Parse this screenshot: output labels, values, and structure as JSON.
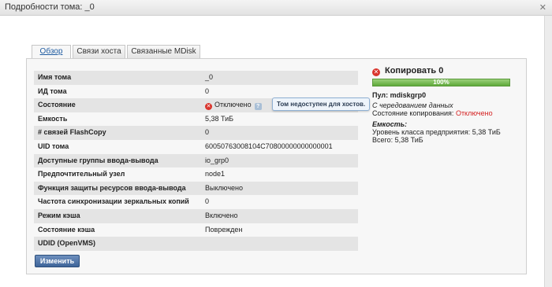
{
  "window": {
    "title": "Подробности тома: _0",
    "close_icon": "close-icon"
  },
  "tabs": [
    {
      "label": "Обзор",
      "active": true
    },
    {
      "label": "Связи хоста",
      "active": false
    },
    {
      "label": "Связанные MDisk",
      "active": false
    }
  ],
  "properties": [
    {
      "label": "Имя тома",
      "value": "_0"
    },
    {
      "label": "ИД тома",
      "value": "0"
    },
    {
      "label": "Состояние",
      "value": "Отключено"
    },
    {
      "label": "Емкость",
      "value": "5,38 ТиБ"
    },
    {
      "label": "# связей FlashCopy",
      "value": "0"
    },
    {
      "label": "UID тома",
      "value": "60050763008104C70800000000000001"
    },
    {
      "label": "Доступные группы ввода-вывода",
      "value": "io_grp0"
    },
    {
      "label": "Предпочтительный узел",
      "value": "node1"
    },
    {
      "label": "Функция защиты ресурсов ввода-вывода",
      "value": "Выключено"
    },
    {
      "label": "Частота синхронизации зеркальных копий",
      "value": "0"
    },
    {
      "label": "Режим кэша",
      "value": "Включено"
    },
    {
      "label": "Состояние кэша",
      "value": "Поврежден"
    },
    {
      "label": "UDID (OpenVMS)",
      "value": ""
    }
  ],
  "status_tooltip": "Том недоступен для хостов.",
  "status_icons": {
    "error": "error-icon",
    "help": "help-icon"
  },
  "edit_button": "Изменить",
  "copy": {
    "title": "Копировать 0",
    "progress_label": "100%",
    "progress": 1.0,
    "pool": "Пул: mdiskgrp0",
    "striped": "С чередованием данных",
    "state_label": "Состояние копирования:",
    "state_value": "Отключено",
    "capacity_header": "Емкость:",
    "tier_line": "Уровень класса предприятия: 5,38 ТиБ",
    "total_line": "Всего: 5,38 ТиБ"
  },
  "colors": {
    "error": "#d9342c",
    "progress": "#5ea93a",
    "button": "#3e6499",
    "state_red": "#d42020"
  }
}
